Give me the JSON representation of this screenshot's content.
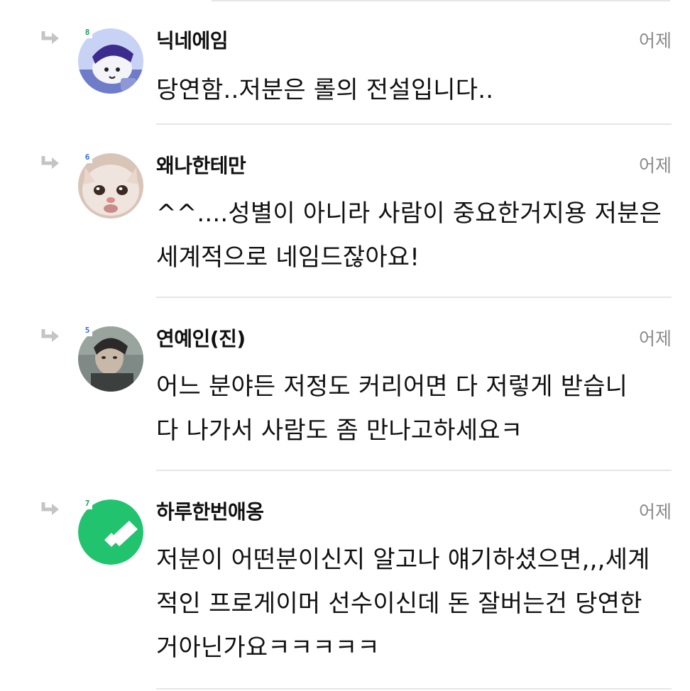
{
  "comments": [
    {
      "nickname": "닉네에임",
      "date": "어제",
      "level": "8",
      "level_color": "#1aa260",
      "avatar": "ghost-cat-avatar",
      "lines": [
        "당연함..저분은 롤의 전설입니다.."
      ]
    },
    {
      "nickname": "왜나한테만",
      "date": "어제",
      "level": "6",
      "level_color": "#2b6cd8",
      "avatar": "crying-cat-avatar",
      "lines": [
        "^^....성별이 아니라 사람이 중요한거지용 저분은",
        "세계적으로 네임드잖아요!"
      ]
    },
    {
      "nickname": "연예인(진)",
      "date": "어제",
      "level": "5",
      "level_color": "#2b6cd8",
      "avatar": "person-photo-avatar",
      "lines": [
        "어느 분야든 저정도 커리어면 다 저렇게 받습니",
        "다 나가서 사람도 좀 만나고하세요ㅋ"
      ]
    },
    {
      "nickname": "하루한번애옹",
      "date": "어제",
      "level": "7",
      "level_color": "#1aa260",
      "avatar": "green-check-avatar",
      "lines": [
        "저분이 어떤분이신지 알고나 얘기하셨으면,,,세계",
        "적인 프로게이머 선수이신데 돈 잘버는건 당연한",
        "거아닌가요ㅋㅋㅋㅋㅋ"
      ]
    }
  ],
  "icons": {
    "reply": "reply-arrow-icon"
  }
}
